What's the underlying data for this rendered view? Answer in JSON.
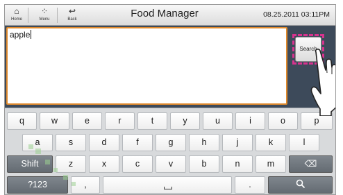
{
  "topbar": {
    "nav": [
      {
        "icon": "home-icon",
        "glyph": "⌂",
        "label": "Home"
      },
      {
        "icon": "menu-icon",
        "glyph": "⁘",
        "label": "Menu"
      },
      {
        "icon": "back-icon",
        "glyph": "↩",
        "label": "Back"
      }
    ],
    "title": "Food Manager",
    "datetime": "08.25.2011 03:11PM"
  },
  "input": {
    "value": "apple"
  },
  "search": {
    "label": "Search"
  },
  "keyboard": {
    "row1": [
      "q",
      "w",
      "e",
      "r",
      "t",
      "y",
      "u",
      "i",
      "o",
      "p"
    ],
    "row2": [
      "a",
      "s",
      "d",
      "f",
      "g",
      "h",
      "j",
      "k",
      "l"
    ],
    "row3": {
      "shift": "Shift",
      "keys": [
        "z",
        "x",
        "c",
        "v",
        "b",
        "n",
        "m"
      ],
      "backspace_glyph": "⌫"
    },
    "row4": {
      "mode": "?123",
      "comma": ",",
      "period": ".",
      "search_glyph": "🔍"
    }
  },
  "colors": {
    "accent_border": "#e08a2c",
    "highlight": "#d8338e",
    "background": "#3d4a5a"
  }
}
